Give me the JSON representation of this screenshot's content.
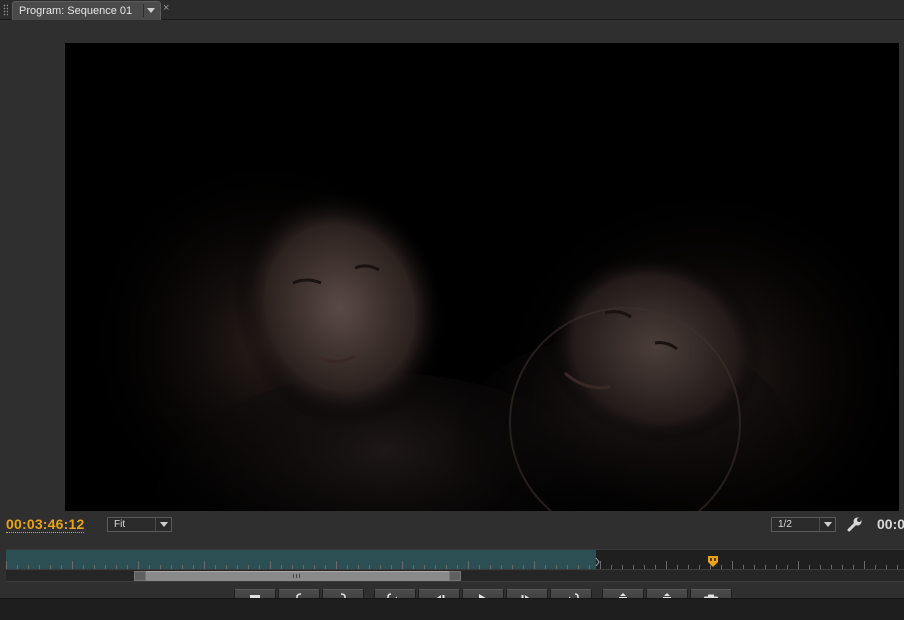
{
  "tab": {
    "title": "Program: Sequence 01",
    "menu_icon": "panel-menu-chevron-icon",
    "close_glyph": "×"
  },
  "viewer": {
    "content": "video-frame"
  },
  "controls": {
    "current_timecode": "00:03:46:12",
    "zoom_level": "Fit",
    "resolution": "1/2",
    "settings_icon": "wrench-icon",
    "duration_timecode": "00:0"
  },
  "timeline": {
    "playhead_position": 0.787,
    "played_fraction": 0.657
  },
  "transport": [
    {
      "name": "add-marker-button",
      "icon": "marker-icon"
    },
    {
      "name": "mark-in-button",
      "icon": "mark-in-icon"
    },
    {
      "name": "mark-out-button",
      "icon": "mark-out-icon"
    },
    {
      "name": "go-to-in-button",
      "icon": "go-to-in-icon"
    },
    {
      "name": "step-back-button",
      "icon": "step-back-icon"
    },
    {
      "name": "play-button",
      "icon": "play-icon"
    },
    {
      "name": "step-forward-button",
      "icon": "step-forward-icon"
    },
    {
      "name": "go-to-out-button",
      "icon": "go-to-out-icon"
    },
    {
      "name": "lift-button",
      "icon": "lift-icon"
    },
    {
      "name": "extract-button",
      "icon": "extract-icon"
    },
    {
      "name": "export-frame-button",
      "icon": "camera-icon"
    }
  ],
  "colors": {
    "timecode": "#e8a317",
    "played_region": "#2b4f52",
    "playhead": "#e8a317"
  }
}
